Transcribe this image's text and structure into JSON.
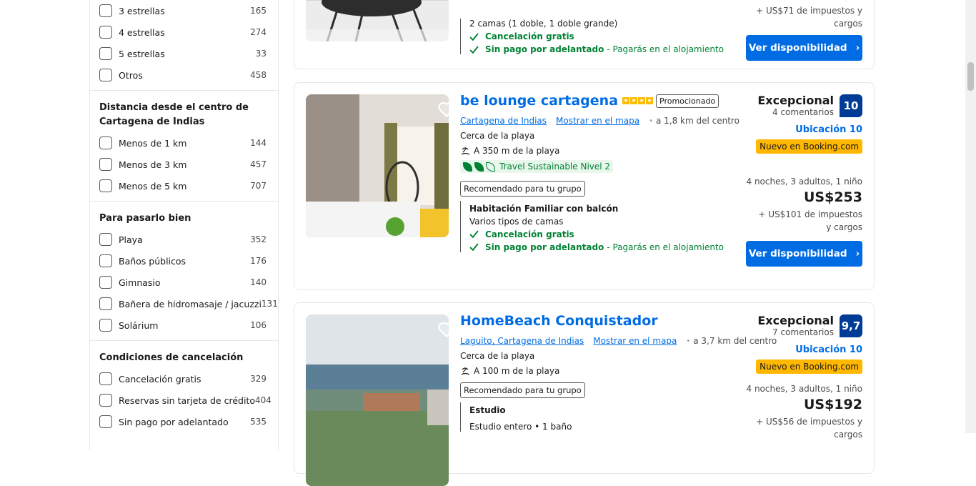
{
  "filters": {
    "stars": [
      {
        "label": "3 estrellas",
        "count": "165"
      },
      {
        "label": "4 estrellas",
        "count": "274"
      },
      {
        "label": "5 estrellas",
        "count": "33"
      },
      {
        "label": "Otros",
        "count": "458"
      }
    ],
    "distance": {
      "title": "Distancia desde el centro de Cartagena de Indias",
      "items": [
        {
          "label": "Menos de 1 km",
          "count": "144"
        },
        {
          "label": "Menos de 3 km",
          "count": "457"
        },
        {
          "label": "Menos de 5 km",
          "count": "707"
        }
      ]
    },
    "fun": {
      "title": "Para pasarlo bien",
      "items": [
        {
          "label": "Playa",
          "count": "352"
        },
        {
          "label": "Baños públicos",
          "count": "176"
        },
        {
          "label": "Gimnasio",
          "count": "140"
        },
        {
          "label": "Bañera de hidromasaje / jacuzzi",
          "count": "131"
        },
        {
          "label": "Solárium",
          "count": "106"
        }
      ]
    },
    "cancel": {
      "title": "Condiciones de cancelación",
      "items": [
        {
          "label": "Cancelación gratis",
          "count": "329"
        },
        {
          "label": "Reservas sin tarjeta de crédito",
          "count": "404"
        },
        {
          "label": "Sin pago por adelantado",
          "count": "535"
        }
      ]
    }
  },
  "card0": {
    "beds": "2 camas (1 doble, 1 doble grande)",
    "free_cancel": "Cancelación gratis",
    "no_prepay": "Sin pago por adelantado",
    "no_prepay_note": "- Pagarás en el alojamiento",
    "tax": "+ US$71 de impuestos y cargos",
    "button": "Ver disponibilidad"
  },
  "card1": {
    "title": "be lounge cartagena",
    "promo": "Promocionado",
    "city": "Cartagena de Indias",
    "map": "Mostrar en el mapa",
    "distance": "a 1,8 km del centro",
    "near_beach": "Cerca de la playa",
    "beach_dist": "A 350 m de la playa",
    "sustainable": "Travel Sustainable Nivel 2",
    "recommended": "Recomendado para tu grupo",
    "room_title": "Habitación Familiar con balcón",
    "room_beds": "Varios tipos de camas",
    "free_cancel": "Cancelación gratis",
    "no_prepay": "Sin pago por adelantado",
    "no_prepay_note": "- Pagarás en el alojamiento",
    "score_word": "Excepcional",
    "reviews": "4 comentarios",
    "score": "10",
    "location_score": "Ubicación 10",
    "new_badge": "Nuevo en Booking.com",
    "nights": "4 noches, 3 adultos, 1 niño",
    "price": "US$253",
    "tax": "+ US$101 de impuestos y cargos",
    "button": "Ver disponibilidad"
  },
  "card2": {
    "title": "HomeBeach Conquistador",
    "city": "Laguito, Cartagena de Indias",
    "map": "Mostrar en el mapa",
    "distance": "a 3,7 km del centro",
    "near_beach": "Cerca de la playa",
    "beach_dist": "A 100 m de la playa",
    "recommended": "Recomendado para tu grupo",
    "room_title": "Estudio",
    "room_beds": "Estudio entero • 1 baño",
    "score_word": "Excepcional",
    "reviews": "7 comentarios",
    "score": "9,7",
    "location_score": "Ubicación 10",
    "new_badge": "Nuevo en Booking.com",
    "nights": "4 noches, 3 adultos, 1 niño",
    "price": "US$192",
    "tax": "+ US$56 de impuestos y cargos"
  },
  "colors": {
    "accent": "#006ce4",
    "score_bg": "#003b95",
    "new_badge": "#ffb700",
    "green": "#008234"
  },
  "icons": [
    "checkbox",
    "heart-icon",
    "check-icon",
    "chevron-right-icon",
    "beach-icon",
    "leaf-icon",
    "star-icon"
  ]
}
